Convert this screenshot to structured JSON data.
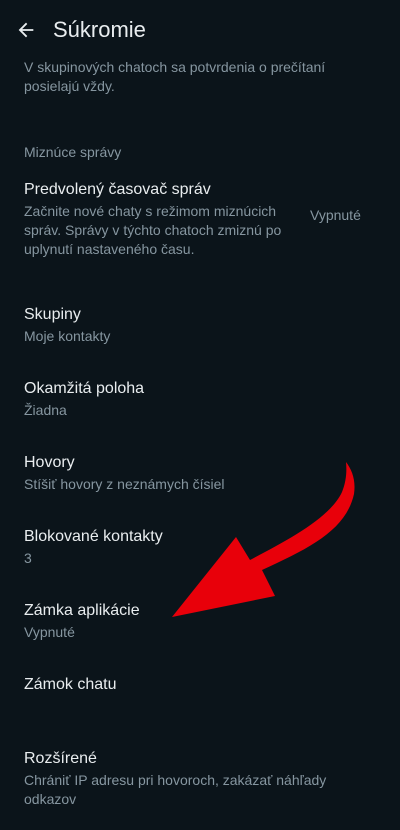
{
  "header": {
    "title": "Súkromie",
    "back_icon": "arrow-left-icon"
  },
  "read_receipts_note": "V skupinových chatoch sa potvrdenia o prečítaní posielajú vždy.",
  "disappearing": {
    "section_title": "Miznúce správy",
    "timer_title": "Predvolený časovač správ",
    "timer_subtitle": "Začnite nové chaty s režimom miznúcich správ. Správy v týchto chatoch zmiznú po uplynutí nastaveného času.",
    "timer_value": "Vypnuté"
  },
  "items": [
    {
      "title": "Skupiny",
      "subtitle": "Moje kontakty"
    },
    {
      "title": "Okamžitá poloha",
      "subtitle": "Žiadna"
    },
    {
      "title": "Hovory",
      "subtitle": "Stíšiť hovory z neznámych čísiel"
    },
    {
      "title": "Blokované kontakty",
      "subtitle": "3"
    },
    {
      "title": "Zámka aplikácie",
      "subtitle": "Vypnuté"
    },
    {
      "title": "Zámok chatu",
      "subtitle": ""
    },
    {
      "title": "Rozšírené",
      "subtitle": "Chrániť IP adresu pri hovoroch, zakázať náhľady odkazov"
    }
  ],
  "colors": {
    "background": "#0b141a",
    "primary_text": "#e9edef",
    "secondary_text": "#8696a0",
    "annotation_arrow": "#e8000a"
  },
  "annotation": {
    "icon": "curved-red-arrow-icon"
  }
}
